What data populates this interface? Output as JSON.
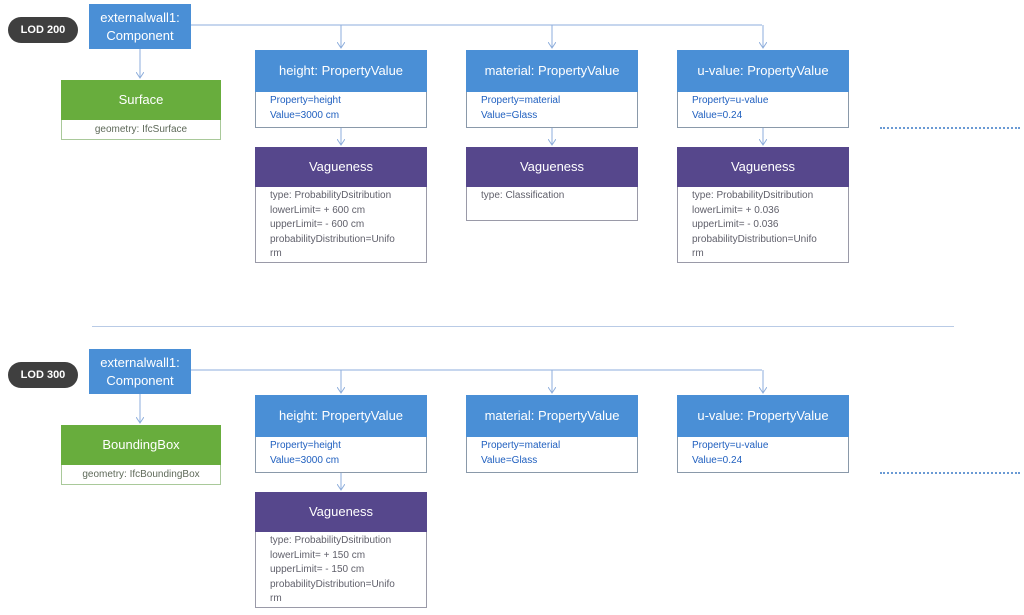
{
  "sections": [
    {
      "lod": "LOD 200",
      "component": {
        "title": "externalwall1:\nComponent"
      },
      "geometry": {
        "title": "Surface",
        "text": "geometry: IfcSurface"
      },
      "properties": [
        {
          "title": "height: PropertyValue",
          "text": "Property=height\nValue=3000 cm",
          "vagueness": {
            "title": "Vagueness",
            "text": "type: ProbabilityDsitribution\nlowerLimit= + 600 cm\nupperLimit= - 600 cm\nprobabilityDistribution=Unifo\nrm"
          }
        },
        {
          "title": "material: PropertyValue",
          "text": "Property=material\nValue=Glass",
          "vagueness": {
            "title": "Vagueness",
            "text": "type: Classification"
          }
        },
        {
          "title": "u-value: PropertyValue",
          "text": "Property=u-value\nValue=0.24",
          "vagueness": {
            "title": "Vagueness",
            "text": "type: ProbabilityDsitribution\nlowerLimit= + 0.036\nupperLimit= - 0.036\nprobabilityDistribution=Unifo\nrm"
          }
        }
      ]
    },
    {
      "lod": "LOD 300",
      "component": {
        "title": "externalwall1:\nComponent"
      },
      "geometry": {
        "title": "BoundingBox",
        "text": "geometry: IfcBoundingBox"
      },
      "properties": [
        {
          "title": "height: PropertyValue",
          "text": "Property=height\nValue=3000 cm",
          "vagueness": {
            "title": "Vagueness",
            "text": "type: ProbabilityDsitribution\nlowerLimit= + 150 cm\nupperLimit= - 150 cm\nprobabilityDistribution=Unifo\nrm"
          }
        },
        {
          "title": "material: PropertyValue",
          "text": "Property=material\nValue=Glass"
        },
        {
          "title": "u-value: PropertyValue",
          "text": "Property=u-value\nValue=0.24"
        }
      ]
    }
  ],
  "colors": {
    "component": "#4a8fd6",
    "property_header": "#4a8fd6",
    "vagueness_header": "#56478c",
    "geometry_header": "#68ad3d",
    "lod_badge": "#3f3f3f",
    "connector": "#8eaedc"
  }
}
